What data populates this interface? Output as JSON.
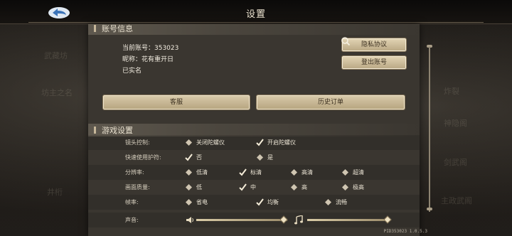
{
  "header": {
    "title": "设置"
  },
  "account": {
    "section_title": "账号信息",
    "current_account": "当前账号：353023",
    "nickname": "昵称：花有重开日",
    "real_name": "已实名",
    "privacy_button": "隐私协议",
    "logout_button": "登出账号",
    "service_button": "客服",
    "history_button": "历史订单"
  },
  "game": {
    "section_title": "游戏设置",
    "rows": [
      {
        "label": "镜头控制:",
        "options": [
          {
            "text": "关闭陀螺仪",
            "selected": false
          },
          {
            "text": "开启陀螺仪",
            "selected": true
          }
        ]
      },
      {
        "label": "快速使用护符:",
        "options": [
          {
            "text": "否",
            "selected": true
          },
          {
            "text": "是",
            "selected": false
          }
        ]
      },
      {
        "label": "分辨率:",
        "options": [
          {
            "text": "低清",
            "selected": false
          },
          {
            "text": "标清",
            "selected": true
          },
          {
            "text": "高清",
            "selected": false
          },
          {
            "text": "超清",
            "selected": false
          }
        ]
      },
      {
        "label": "画面质量:",
        "options": [
          {
            "text": "低",
            "selected": false
          },
          {
            "text": "中",
            "selected": true
          },
          {
            "text": "高",
            "selected": false
          },
          {
            "text": "极高",
            "selected": false
          }
        ]
      },
      {
        "label": "帧率:",
        "options": [
          {
            "text": "省电",
            "selected": false
          },
          {
            "text": "均衡",
            "selected": true
          },
          {
            "text": "流畅",
            "selected": false
          }
        ]
      }
    ],
    "sound": {
      "label": "声音:",
      "sound_level": 0.96,
      "music_level": 0.97
    }
  },
  "footer": {
    "pid": "PID353023 1.0.5.3"
  },
  "background_labels": [
    "武藏坊",
    "坊主之名",
    "井桁",
    "神隐阁",
    "炸裂",
    "剑武阁",
    "主政武阁"
  ],
  "colors": {
    "accent": "#c6b79a",
    "button": "#d9cbab",
    "panel": "#3a3630"
  }
}
